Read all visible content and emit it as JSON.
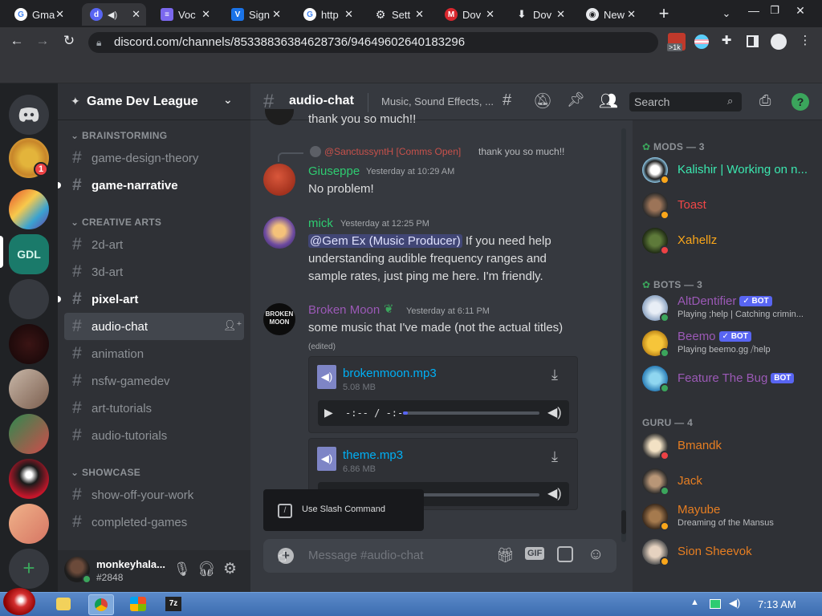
{
  "browser": {
    "tabs": [
      {
        "label": "Gma",
        "icon": "gmail-icon",
        "color": "#4285f4",
        "active": false
      },
      {
        "label": "a",
        "icon": "discord-icon",
        "color": "#5865f2",
        "active": true
      },
      {
        "label": "Voc",
        "icon": "doc-icon",
        "color": "#7b68ee",
        "active": false
      },
      {
        "label": "Sign",
        "icon": "vl-icon",
        "color": "#1a73e8",
        "active": false
      },
      {
        "label": "http",
        "icon": "google-icon",
        "color": "#4285f4",
        "active": false
      },
      {
        "label": "Sett",
        "icon": "gear-icon",
        "color": "#9aa0a6",
        "active": false
      },
      {
        "label": "Dov",
        "icon": "mega-icon",
        "color": "#d9272e",
        "active": false
      },
      {
        "label": "Dov",
        "icon": "download-icon",
        "color": "#9aa0a6",
        "active": false
      },
      {
        "label": "New",
        "icon": "chrome-icon",
        "color": "#9aa0a6",
        "active": false
      }
    ],
    "url": "discord.com/channels/853388363846287​36/946496026401832​96",
    "ext_badge": ">1k"
  },
  "server": {
    "name": "Game Dev League"
  },
  "categories": {
    "brainstorming": "BRAINSTORMING",
    "creative": "CREATIVE ARTS",
    "showcase": "SHOWCASE"
  },
  "channels": {
    "c1": "game-design-theory",
    "c2": "game-narrative",
    "c3": "2d-art",
    "c4": "3d-art",
    "c5": "pixel-art",
    "c6": "audio-chat",
    "c7": "animation",
    "c8": "nsfw-gamedev",
    "c9": "art-tutorials",
    "c10": "audio-tutorials",
    "c11": "show-off-your-work",
    "c12": "completed-games"
  },
  "guild_badge": "1",
  "user": {
    "name": "monkeyhala...",
    "tag": "#2848"
  },
  "header": {
    "channel": "audio-chat",
    "topic": "Music, Sound Effects, ...",
    "search": "Search"
  },
  "messages": {
    "m0_text": "thank you so much!!",
    "reply_name": "@SanctussyntH [Comms Open]",
    "reply_text": "thank you so much!!",
    "m1": {
      "author": "Giuseppe",
      "time": "Yesterday at 10:29 AM",
      "text": "No problem!"
    },
    "m2": {
      "author": "mick",
      "time": "Yesterday at 12:25 PM",
      "mention": "@Gem Ex (Music Producer)",
      "text1": " If you need help",
      "text2": "understanding audible frequency ranges and",
      "text3": "sample rates, just ping me here. I'm friendly."
    },
    "m3": {
      "author": "Broken Moon",
      "time": "Yesterday at 6:11 PM",
      "text": "some music that I've made (not the actual titles)",
      "edited": "(edited)",
      "avatar_text": "BROKEN MOON"
    },
    "files": [
      {
        "name": "brokenmoon.mp3",
        "size": "5.08 MB",
        "time": "-:-- / -:--"
      },
      {
        "name": "theme.mp3",
        "size": "6.86 MB"
      }
    ]
  },
  "tooltip": "Use Slash Command",
  "composer": {
    "placeholder": "Message #audio-chat",
    "gif": "GIF"
  },
  "members": {
    "mods_hdr": "MODS — 3",
    "bots_hdr": "BOTS — 3",
    "guru_hdr": "GURU — 4",
    "mods": [
      {
        "name": "Kalishir | Working on n...",
        "color": "#3be8b0",
        "status": "#faa61a"
      },
      {
        "name": "Toast",
        "color": "#f04747",
        "status": "#faa61a"
      },
      {
        "name": "Xahellz",
        "color": "#faa61a",
        "status": "#ed4245"
      }
    ],
    "bots": [
      {
        "name": "AltDentifier",
        "color": "#9b59b6",
        "activity": "Playing ;help | Catching crimin...",
        "badge": "✓ BOT",
        "status": "#3ba55c"
      },
      {
        "name": "Beemo",
        "color": "#9b59b6",
        "activity": "Playing beemo.gg ⧸help",
        "badge": "✓ BOT",
        "status": "#3ba55c"
      },
      {
        "name": "Feature The Bug",
        "color": "#9b59b6",
        "badge": "BOT",
        "status": "#3ba55c"
      }
    ],
    "gurus": [
      {
        "name": "Bmandk",
        "color": "#e67e22",
        "status": "#ed4245"
      },
      {
        "name": "Jack",
        "color": "#e67e22",
        "status": "#3ba55c"
      },
      {
        "name": "Mayube",
        "color": "#e67e22",
        "activity": "Dreaming of the Mansus",
        "status": "#faa61a"
      },
      {
        "name": "Sion Sheevok",
        "color": "#e67e22",
        "status": "#faa61a"
      }
    ]
  },
  "taskbar": {
    "clock": "7:13 AM"
  }
}
